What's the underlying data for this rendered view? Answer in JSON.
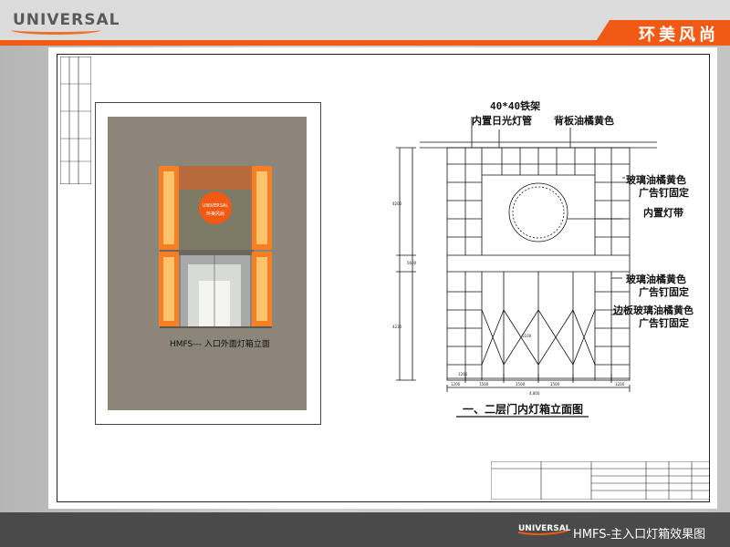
{
  "header": {
    "logo_text": "UNIVERSAL",
    "brand_name": "环美风尚",
    "accent_color": "#f05a14"
  },
  "render": {
    "caption": "HMFS--- 入口外面灯箱立面",
    "logo_text": "UNIVERSAL",
    "logo_subtext": "环美风尚"
  },
  "drawing": {
    "title": "一、二层门内灯箱立面图",
    "annotations": {
      "frame": "40*40铁架",
      "tube": "内置日光灯管",
      "backboard": "背板油橘黄色",
      "glass_upper": "玻璃油橘黄色",
      "nail_upper": "广告钉固定",
      "light_strip": "内置灯带",
      "glass_lower": "玻璃油橘黄色",
      "nail_lower": "广告钉固定",
      "side_glass": "边板玻璃油橘黄色",
      "nail_side": "广告钉固定"
    },
    "dims": {
      "d1": "4200",
      "d2": "4230",
      "d3": "5600",
      "d4": "1200",
      "d5": "5100",
      "w1": "1200",
      "w2": "1500",
      "w3": "1500",
      "w4": "1500",
      "w5": "1200",
      "w_total": "4,800"
    }
  },
  "footer": {
    "logo_text": "UNIVERSAL",
    "title": "HMFS-主入口灯箱效果图"
  }
}
